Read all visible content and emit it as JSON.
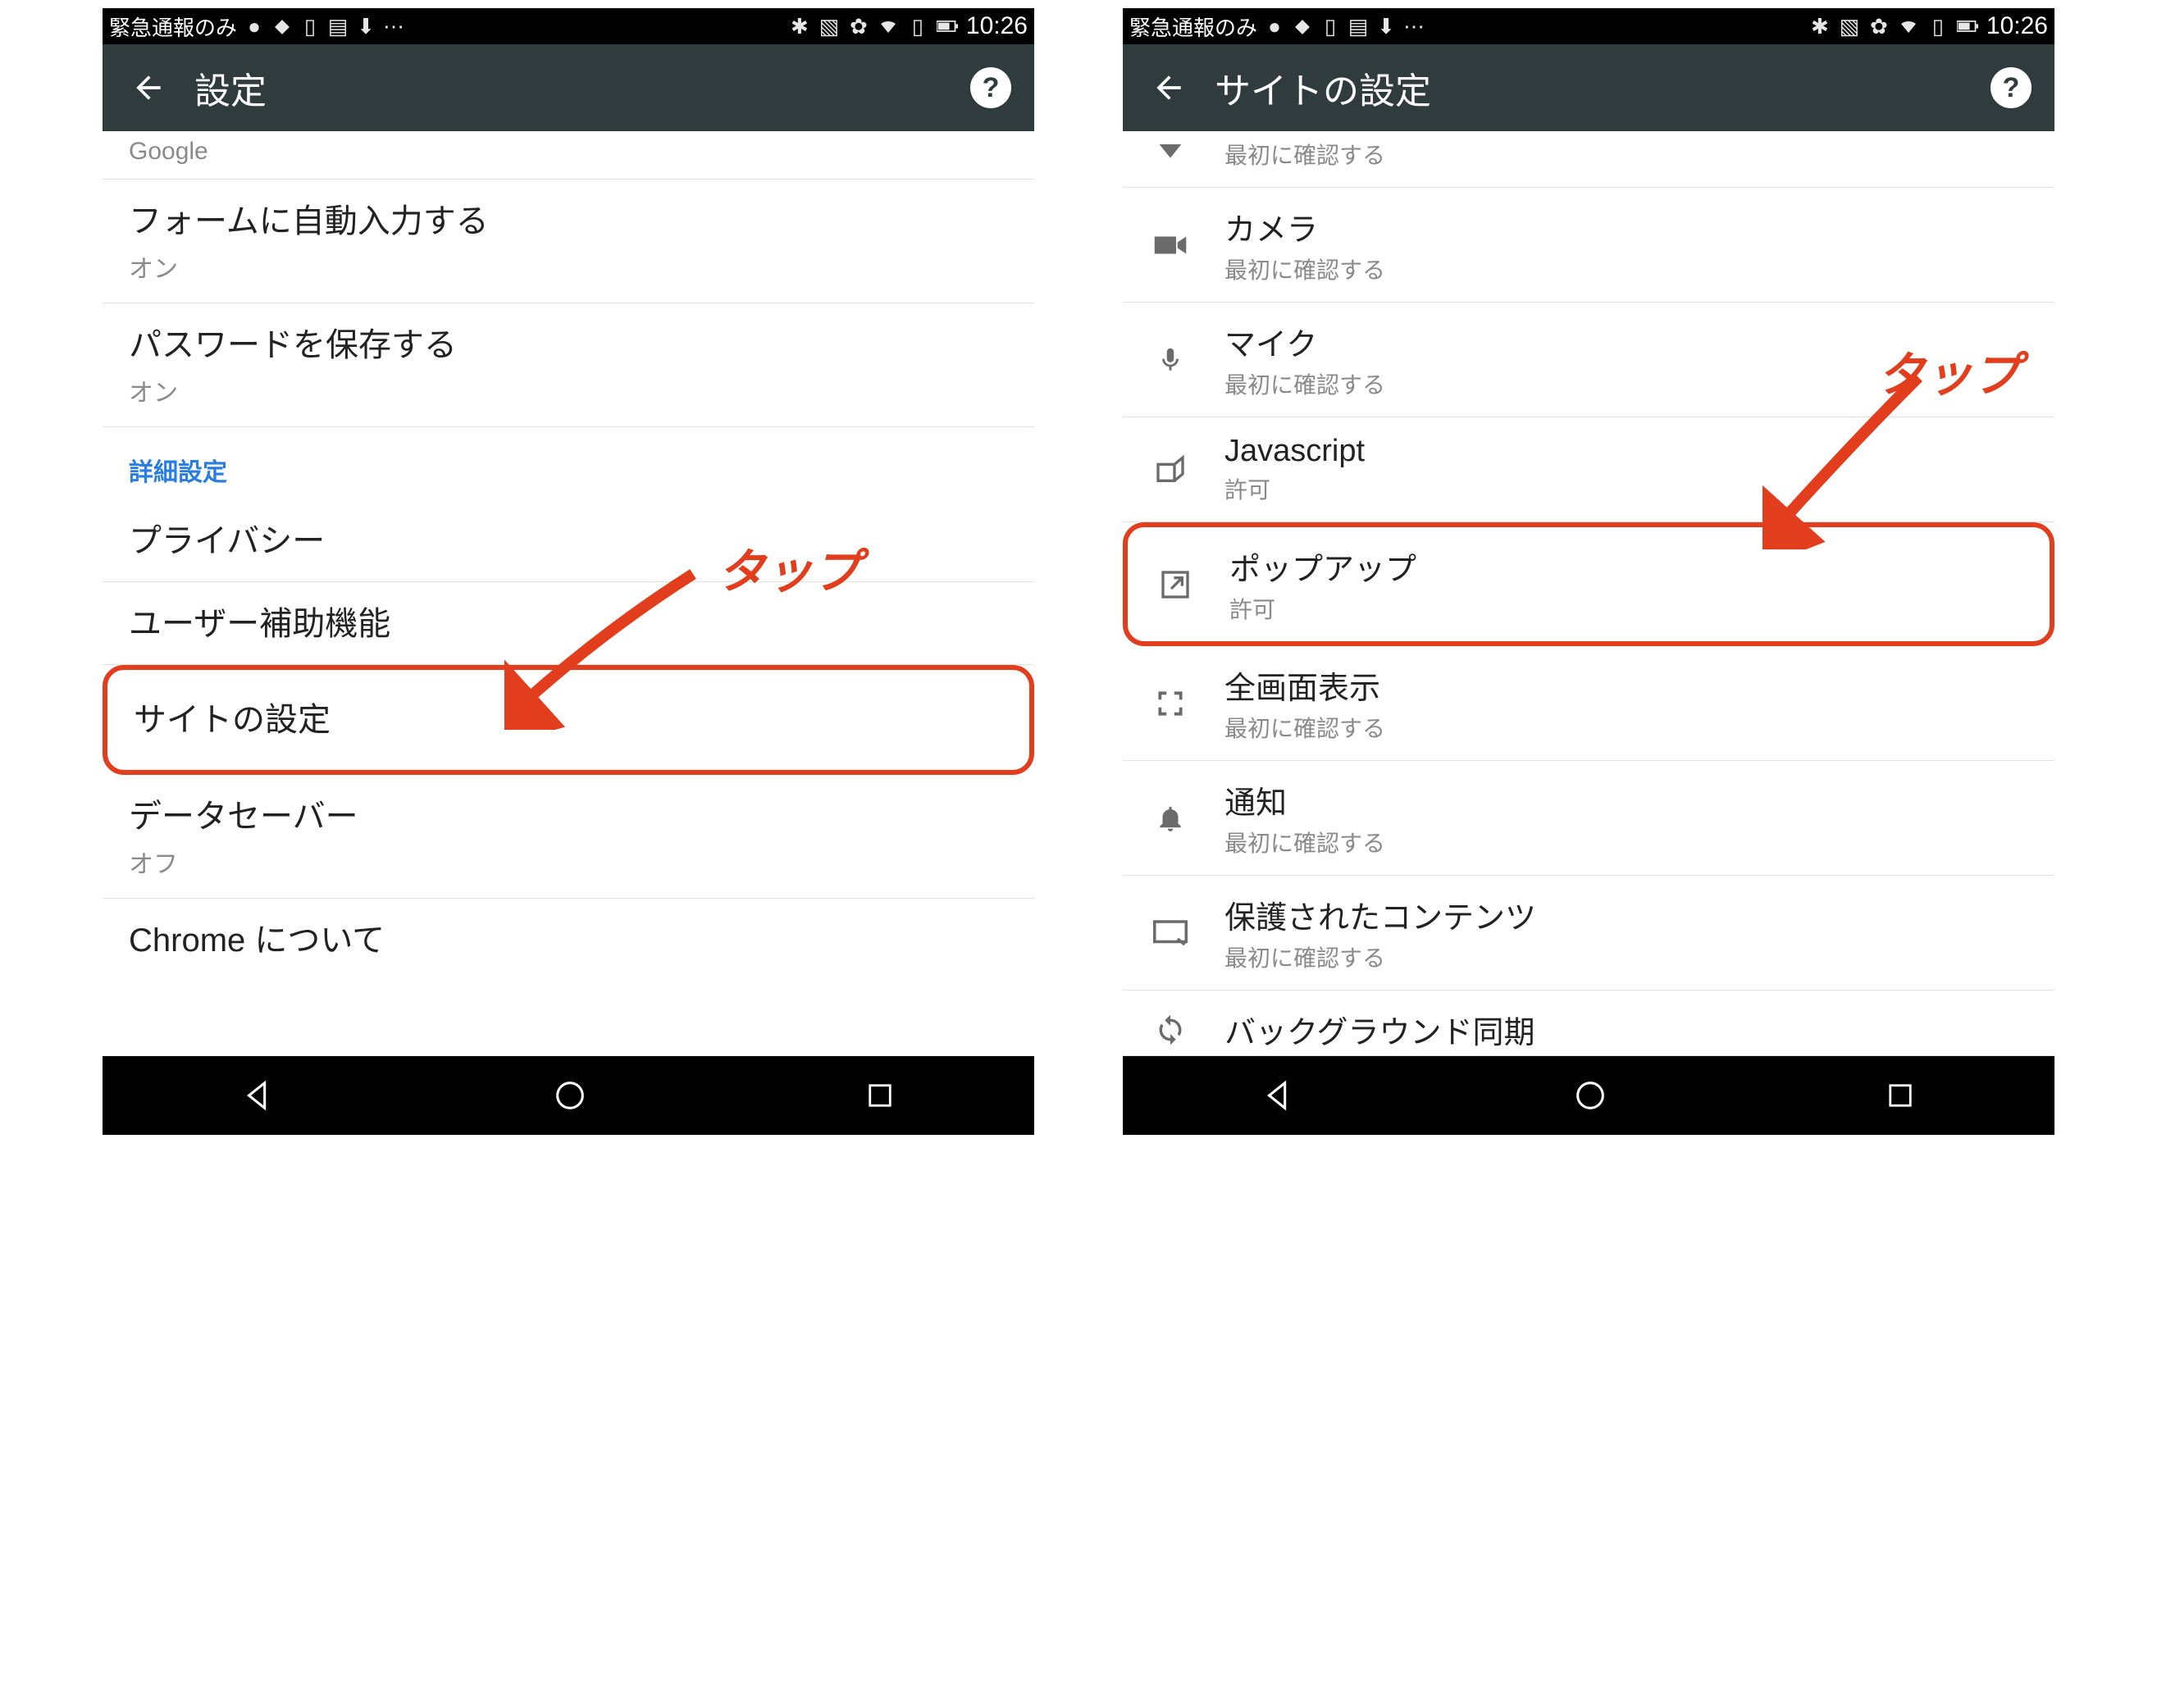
{
  "status": {
    "carrier": "緊急通報のみ",
    "clock": "10:26"
  },
  "left": {
    "title": "設定",
    "rows": {
      "google_sub": "Google",
      "autofill_title": "フォームに自動入力する",
      "autofill_sub": "オン",
      "passwords_title": "パスワードを保存する",
      "passwords_sub": "オン",
      "section_advanced": "詳細設定",
      "privacy_title": "プライバシー",
      "accessibility_title": "ユーザー補助機能",
      "site_settings_title": "サイトの設定",
      "data_saver_title": "データセーバー",
      "data_saver_sub": "オフ",
      "about_title": "Chrome について"
    },
    "tap_label": "タップ"
  },
  "right": {
    "title": "サイトの設定",
    "rows": {
      "location_sub": "最初に確認する",
      "camera_title": "カメラ",
      "camera_sub": "最初に確認する",
      "mic_title": "マイク",
      "mic_sub": "最初に確認する",
      "js_title": "Javascript",
      "js_sub": "許可",
      "popup_title": "ポップアップ",
      "popup_sub": "許可",
      "fullscreen_title": "全画面表示",
      "fullscreen_sub": "最初に確認する",
      "notif_title": "通知",
      "notif_sub": "最初に確認する",
      "protected_title": "保護されたコンテンツ",
      "protected_sub": "最初に確認する",
      "bgsync_title": "バックグラウンド同期"
    },
    "tap_label": "タップ"
  }
}
